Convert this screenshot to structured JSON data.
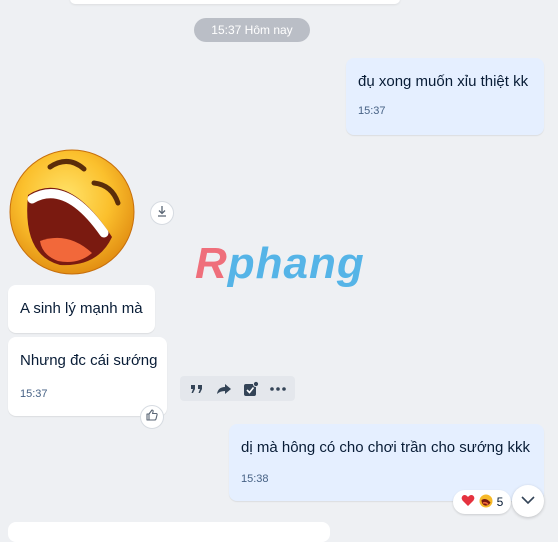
{
  "conversation": {
    "date_separator": "15:37 Hôm nay",
    "messages": [
      {
        "side": "me",
        "text": "đụ xong muốn xỉu thiệt kk",
        "time": "15:37"
      },
      {
        "side": "them",
        "type": "sticker",
        "sticker": "laughing-emoji-sticker"
      },
      {
        "side": "them",
        "text": "A sinh lý mạnh mà"
      },
      {
        "side": "them",
        "text": "Nhưng đc cái sướng",
        "time": "15:37"
      },
      {
        "side": "me",
        "text": "dị mà hông có cho chơi trần cho sướng kkk",
        "time": "15:38"
      }
    ],
    "reaction": {
      "icons": [
        "heart",
        "laughing"
      ],
      "count": "5"
    }
  },
  "watermark": {
    "first": "R",
    "rest": "phang"
  },
  "message_toolbar": [
    "quote-icon",
    "forward-icon",
    "task-check-icon",
    "more-icon"
  ],
  "colors": {
    "background": "#eef0f3",
    "my_bubble": "#e5efff",
    "their_bubble": "#ffffff",
    "time_text": "#476285",
    "watermark_r": "#ef6f7b",
    "watermark_rest": "#55b4e7"
  }
}
